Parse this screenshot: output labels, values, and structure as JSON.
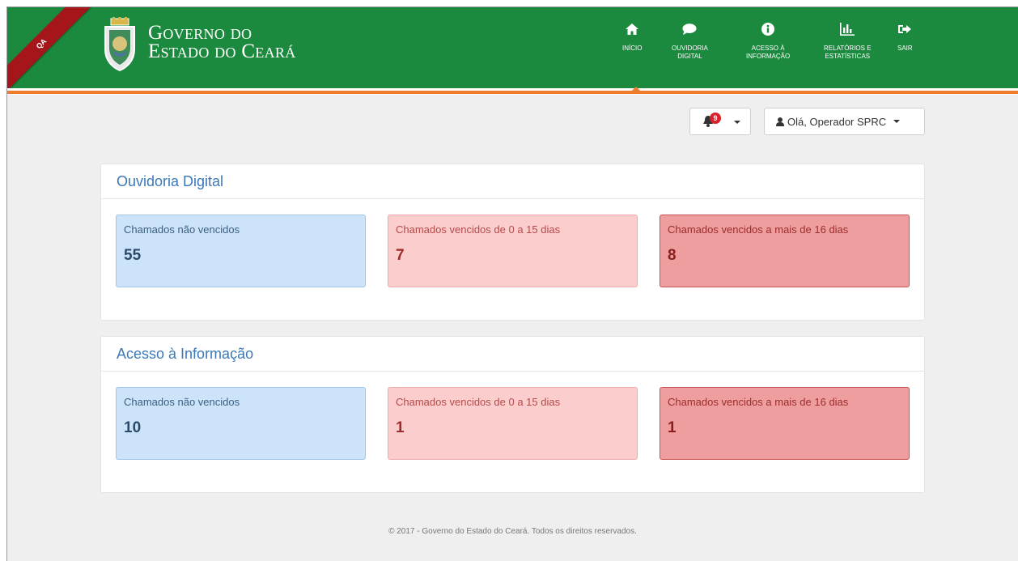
{
  "qa_tag": "QA",
  "brand": {
    "line1": "Governo do",
    "line2": "Estado do Ceará"
  },
  "nav": [
    {
      "label": "Início",
      "icon": "home-icon"
    },
    {
      "label": "Ouvidoria\nDigital",
      "icon": "comment-icon"
    },
    {
      "label": "Acesso à\nInformação",
      "icon": "info-icon"
    },
    {
      "label": "Relatórios e\nEstatísticas",
      "icon": "bar-chart-icon"
    },
    {
      "label": "Sair",
      "icon": "sign-out-icon"
    }
  ],
  "notifications": {
    "count": "9"
  },
  "user_menu": {
    "label": "Olá, Operador SPRC"
  },
  "panels": [
    {
      "title": "Ouvidoria Digital",
      "cards": [
        {
          "title": "Chamados não vencidos",
          "value": "55"
        },
        {
          "title": "Chamados vencidos de 0 a 15 dias",
          "value": "7"
        },
        {
          "title": "Chamados vencidos a mais de 16 dias",
          "value": "8"
        }
      ]
    },
    {
      "title": "Acesso à Informação",
      "cards": [
        {
          "title": "Chamados não vencidos",
          "value": "10"
        },
        {
          "title": "Chamados vencidos de 0 a 15 dias",
          "value": "1"
        },
        {
          "title": "Chamados vencidos a mais de 16 dias",
          "value": "1"
        }
      ]
    }
  ],
  "footer": "© 2017 - Governo do Estado do Ceará. Todos os direitos reservados.",
  "colors": {
    "header_green": "#1b8a3e",
    "accent_orange": "#ef7b2d",
    "ribbon_red": "#a4161a",
    "panel_title_blue": "#3b79b8"
  }
}
